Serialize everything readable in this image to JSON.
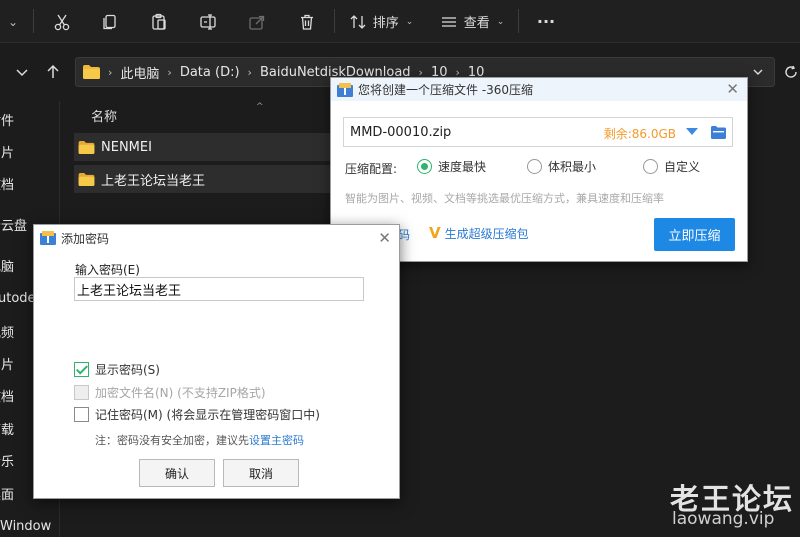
{
  "toolbar": {
    "left_caret": "⌄",
    "sort_label": "排序",
    "view_label": "查看",
    "more_label": "···"
  },
  "address": {
    "crumbs": [
      "此电脑",
      "Data (D:)",
      "BaiduNetdiskDownload",
      "10",
      "10"
    ]
  },
  "sidebar": {
    "items": [
      "附件",
      "图片",
      "文档",
      "云云盘",
      "电脑",
      "utodesk",
      "视频",
      "图片",
      "文档",
      "下载",
      "音乐",
      "桌面",
      "Window"
    ]
  },
  "filelist": {
    "column_name": "名称",
    "files": [
      "NENMEI",
      "上老王论坛当老王"
    ]
  },
  "compress_dialog": {
    "title": "您将创建一个压缩文件 -360压缩",
    "filename": "MMD-00010.zip",
    "remaining": "剩余:86.0GB",
    "config_label": "压缩配置:",
    "options": [
      "速度最快",
      "体积最小",
      "自定义"
    ],
    "selected_option": "速度最快",
    "hint": "智能为图片、视频、文档等挑选最优压缩方式，兼具速度和压缩率",
    "left_link_tail": "码",
    "super_link": "生成超级压缩包",
    "compress_button": "立即压缩"
  },
  "password_dialog": {
    "title": "添加密码",
    "input_label": "输入密码(E)",
    "input_value": "上老王论坛当老王",
    "show_password": {
      "label": "显示密码(S)",
      "checked": true
    },
    "encrypt_names": {
      "label": "加密文件名(N) (不支持ZIP格式)",
      "enabled": false
    },
    "remember": {
      "label": "记住密码(M) (将会显示在管理密码窗口中)",
      "checked": false
    },
    "note_text": "注：密码没有安全加密，建议先",
    "note_link": "设置主密码",
    "ok_button": "确认",
    "cancel_button": "取消"
  },
  "watermark": {
    "cn": "老王论坛",
    "en": "laowang.vip"
  },
  "colors": {
    "accent": "#1e88e5",
    "radio_selected": "#2fb36f",
    "remaining": "#f39a2b",
    "dark_bg": "#1c1c1c"
  }
}
